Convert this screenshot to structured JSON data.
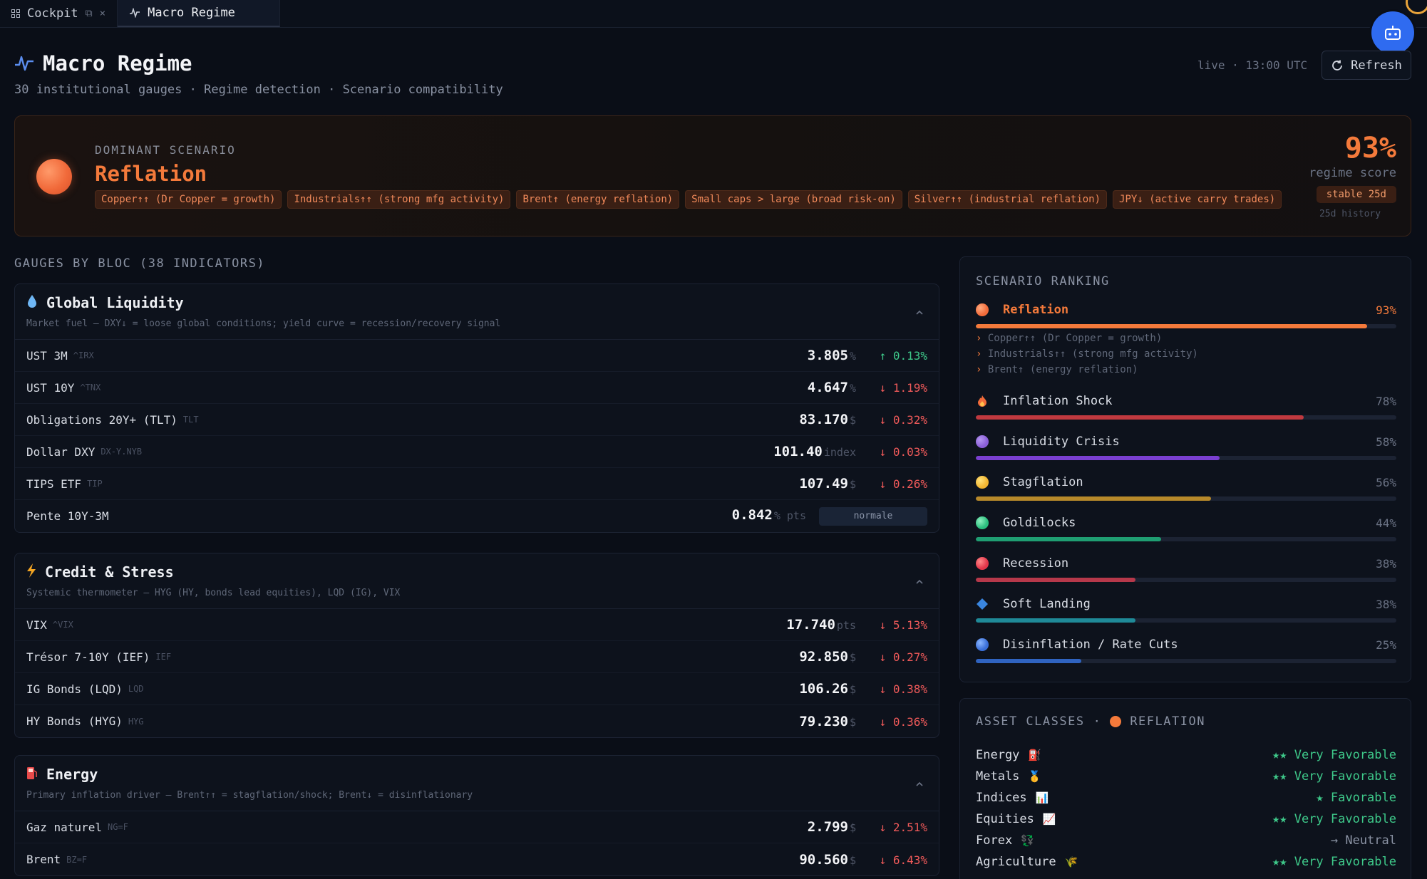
{
  "tabs": [
    {
      "label": "Cockpit",
      "icon": "grid-icon"
    },
    {
      "label": "Macro Regime",
      "icon": "pulse-icon"
    }
  ],
  "header": {
    "title": "Macro Regime",
    "subtitle": "30 institutional gauges · Regime detection · Scenario compatibility",
    "live_status": "live · 13:00 UTC",
    "refresh_label": "Refresh"
  },
  "dominant": {
    "label": "DOMINANT SCENARIO",
    "name": "Reflation",
    "tags": [
      "Copper↑↑ (Dr Copper = growth)",
      "Industrials↑↑ (strong mfg activity)",
      "Brent↑ (energy reflation)",
      "Small caps > large (broad risk-on)",
      "Silver↑↑ (industrial reflation)",
      "JPY↓ (active carry trades)"
    ],
    "score": "93%",
    "score_label": "regime score",
    "stable": "stable 25d",
    "history": "25d history",
    "color": "#f47a3b"
  },
  "gauges": {
    "heading": "GAUGES BY BLOC (38 INDICATORS)",
    "blocs": [
      {
        "title": "Global Liquidity",
        "icon": "droplet-icon",
        "desc": "Market fuel — DXY↓ = loose global conditions; yield curve = recession/recovery signal",
        "rows": [
          {
            "name": "UST 3M",
            "ticker": "^IRX",
            "value": "3.805",
            "unit": "%",
            "change": "↑ 0.13%",
            "dir": "up"
          },
          {
            "name": "UST 10Y",
            "ticker": "^TNX",
            "value": "4.647",
            "unit": "%",
            "change": "↓ 1.19%",
            "dir": "down"
          },
          {
            "name": "Obligations 20Y+ (TLT)",
            "ticker": "TLT",
            "value": "83.170",
            "unit": "$",
            "change": "↓ 0.32%",
            "dir": "down"
          },
          {
            "name": "Dollar DXY",
            "ticker": "DX-Y.NYB",
            "value": "101.40",
            "unit": "index",
            "change": "↓ 0.03%",
            "dir": "down"
          },
          {
            "name": "TIPS ETF",
            "ticker": "TIP",
            "value": "107.49",
            "unit": "$",
            "change": "↓ 0.26%",
            "dir": "down"
          },
          {
            "name": "Pente 10Y-3M",
            "ticker": "",
            "value": "0.842",
            "unit": "% pts",
            "badge": "normale"
          }
        ]
      },
      {
        "title": "Credit & Stress",
        "icon": "lightning-icon",
        "desc": "Systemic thermometer — HYG (HY, bonds lead equities), LQD (IG), VIX",
        "rows": [
          {
            "name": "VIX",
            "ticker": "^VIX",
            "value": "17.740",
            "unit": "pts",
            "change": "↓ 5.13%",
            "dir": "down"
          },
          {
            "name": "Trésor 7-10Y (IEF)",
            "ticker": "IEF",
            "value": "92.850",
            "unit": "$",
            "change": "↓ 0.27%",
            "dir": "down"
          },
          {
            "name": "IG Bonds (LQD)",
            "ticker": "LQD",
            "value": "106.26",
            "unit": "$",
            "change": "↓ 0.38%",
            "dir": "down"
          },
          {
            "name": "HY Bonds (HYG)",
            "ticker": "HYG",
            "value": "79.230",
            "unit": "$",
            "change": "↓ 0.36%",
            "dir": "down"
          }
        ]
      },
      {
        "title": "Energy",
        "icon": "fuel-pump-icon",
        "desc": "Primary inflation driver — Brent↑↑ = stagflation/shock; Brent↓ = disinflationary",
        "rows": [
          {
            "name": "Gaz naturel",
            "ticker": "NG=F",
            "value": "2.799",
            "unit": "$",
            "change": "↓ 2.51%",
            "dir": "down"
          },
          {
            "name": "Brent",
            "ticker": "BZ=F",
            "value": "90.560",
            "unit": "$",
            "change": "↓ 6.43%",
            "dir": "down"
          }
        ]
      }
    ]
  },
  "ranking": {
    "title": "SCENARIO RANKING",
    "scenarios": [
      {
        "name": "Reflation",
        "pct": "93%",
        "value": 0.93,
        "color": "#f47a3b",
        "icon": "orange-orb-icon",
        "reasons": [
          "Copper↑↑ (Dr Copper = growth)",
          "Industrials↑↑ (strong mfg activity)",
          "Brent↑ (energy reflation)"
        ]
      },
      {
        "name": "Inflation Shock",
        "pct": "78%",
        "value": 0.78,
        "color": "#c0393f",
        "icon": "flame-icon"
      },
      {
        "name": "Liquidity Crisis",
        "pct": "58%",
        "value": 0.58,
        "color": "#7a3fd0",
        "icon": "purple-orb-icon"
      },
      {
        "name": "Stagflation",
        "pct": "56%",
        "value": 0.56,
        "color": "#b7892a",
        "icon": "yellow-orb-icon"
      },
      {
        "name": "Goldilocks",
        "pct": "44%",
        "value": 0.44,
        "color": "#1f9e72",
        "icon": "green-orb-icon"
      },
      {
        "name": "Recession",
        "pct": "38%",
        "value": 0.38,
        "color": "#b6384a",
        "icon": "red-orb-icon"
      },
      {
        "name": "Soft Landing",
        "pct": "38%",
        "value": 0.38,
        "color": "#1f8a98",
        "icon": "blue-diamond-icon"
      },
      {
        "name": "Disinflation / Rate Cuts",
        "pct": "25%",
        "value": 0.25,
        "color": "#2f63c0",
        "icon": "blue-orb-icon"
      }
    ]
  },
  "assets": {
    "title": "ASSET CLASSES",
    "scenario": "REFLATION",
    "items": [
      {
        "name": "Energy",
        "emoji": "⛽",
        "rating": "★★ Very Favorable",
        "kind": "fav"
      },
      {
        "name": "Metals",
        "emoji": "🥇",
        "rating": "★★ Very Favorable",
        "kind": "fav"
      },
      {
        "name": "Indices",
        "emoji": "📊",
        "rating": "★ Favorable",
        "kind": "fav"
      },
      {
        "name": "Equities",
        "emoji": "📈",
        "rating": "★★ Very Favorable",
        "kind": "fav"
      },
      {
        "name": "Forex",
        "emoji": "💱",
        "rating": "→ Neutral",
        "kind": "neutral"
      },
      {
        "name": "Agriculture",
        "emoji": "🌾",
        "rating": "★★ Very Favorable",
        "kind": "fav"
      }
    ]
  }
}
